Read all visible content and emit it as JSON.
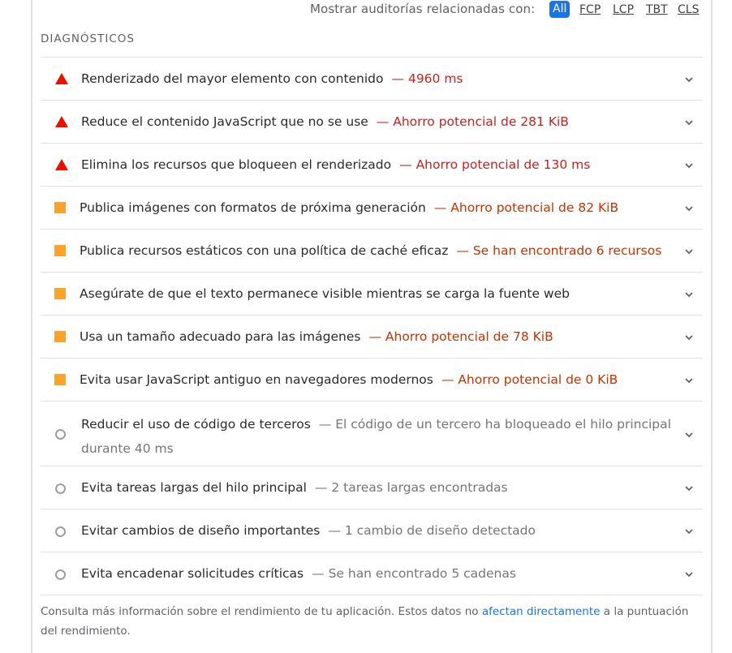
{
  "filter": {
    "label": "Mostrar auditorías relacionadas con:",
    "chips": [
      "All",
      "FCP",
      "LCP",
      "TBT",
      "CLS"
    ],
    "active": "All"
  },
  "section_title": "DIAGNÓSTICOS",
  "audits": [
    {
      "title": "Renderizado del mayor elemento con contenido",
      "separator": "—",
      "detail": "4960 ms",
      "status": "fail",
      "icon": "warning-triangle-icon"
    },
    {
      "title": "Reduce el contenido JavaScript que no se use",
      "separator": "—",
      "detail": "Ahorro potencial de 281 KiB",
      "status": "fail",
      "icon": "warning-triangle-icon"
    },
    {
      "title": "Elimina los recursos que bloqueen el renderizado",
      "separator": "—",
      "detail": "Ahorro potencial de 130 ms",
      "status": "fail",
      "icon": "warning-triangle-icon"
    },
    {
      "title": "Publica imágenes con formatos de próxima generación",
      "separator": "—",
      "detail": "Ahorro potencial de 82 KiB",
      "status": "average",
      "icon": "orange-square-icon"
    },
    {
      "title": "Publica recursos estáticos con una política de caché eficaz",
      "separator": "—",
      "detail": "Se han encontrado 6 recursos",
      "status": "average",
      "icon": "orange-square-icon"
    },
    {
      "title": "Asegúrate de que el texto permanece visible mientras se carga la fuente web",
      "separator": "",
      "detail": "",
      "status": "average",
      "icon": "orange-square-icon"
    },
    {
      "title": "Usa un tamaño adecuado para las imágenes",
      "separator": "—",
      "detail": "Ahorro potencial de 78 KiB",
      "status": "average",
      "icon": "orange-square-icon"
    },
    {
      "title": "Evita usar JavaScript antiguo en navegadores modernos",
      "separator": "—",
      "detail": "Ahorro potencial de 0 KiB",
      "status": "average",
      "icon": "orange-square-icon"
    },
    {
      "title": "Reducir el uso de código de terceros",
      "separator": "—",
      "detail": "El código de un tercero ha bloqueado el hilo principal durante 40 ms",
      "status": "informative",
      "icon": "info-circle-icon"
    },
    {
      "title": "Evita tareas largas del hilo principal",
      "separator": "—",
      "detail": "2 tareas largas encontradas",
      "status": "informative",
      "icon": "info-circle-icon"
    },
    {
      "title": "Evitar cambios de diseño importantes",
      "separator": "—",
      "detail": "1 cambio de diseño detectado",
      "status": "informative",
      "icon": "info-circle-icon"
    },
    {
      "title": "Evita encadenar solicitudes críticas",
      "separator": "—",
      "detail": "Se han encontrado 5 cadenas",
      "status": "informative",
      "icon": "info-circle-icon"
    }
  ],
  "footnote": {
    "before": "Consulta más información sobre el rendimiento de tu aplicación. Estos datos no ",
    "link": "afectan directamente",
    "after": " a la puntuación del rendimiento."
  },
  "colors": {
    "fail": "#eb0f00",
    "average": "#fca32b",
    "accent": "#1a73e8"
  }
}
